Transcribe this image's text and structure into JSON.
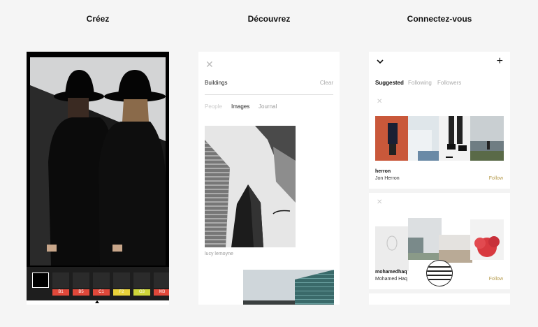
{
  "headings": {
    "create": "Créez",
    "discover": "Découvrez",
    "connect": "Connectez-vous"
  },
  "editor": {
    "filters": [
      {
        "code": "",
        "color": "#1e1e1e"
      },
      {
        "code": "B1",
        "color": "#e0483a"
      },
      {
        "code": "B5",
        "color": "#e0483a"
      },
      {
        "code": "C1",
        "color": "#e0483a"
      },
      {
        "code": "F2",
        "color": "#e9d23a"
      },
      {
        "code": "G3",
        "color": "#cfd63a"
      },
      {
        "code": "M3",
        "color": "#e0483a"
      }
    ]
  },
  "discover": {
    "close_icon": "close-icon",
    "search_value": "Buildings",
    "clear_label": "Clear",
    "tabs": [
      {
        "label": "People",
        "active": false
      },
      {
        "label": "Images",
        "active": true
      },
      {
        "label": "Journal",
        "active": false
      }
    ],
    "image_caption": "lucy lemoyne"
  },
  "connect": {
    "tabs": [
      {
        "label": "Suggested",
        "active": true
      },
      {
        "label": "Following",
        "active": false
      },
      {
        "label": "Followers",
        "active": false
      }
    ],
    "users": [
      {
        "username": "herron",
        "name": "Jon Herron",
        "follow_label": "Follow"
      },
      {
        "username": "mohamedhaq",
        "name": "Mohamed Haq",
        "follow_label": "Follow"
      }
    ],
    "accent": "#b59a4a"
  }
}
